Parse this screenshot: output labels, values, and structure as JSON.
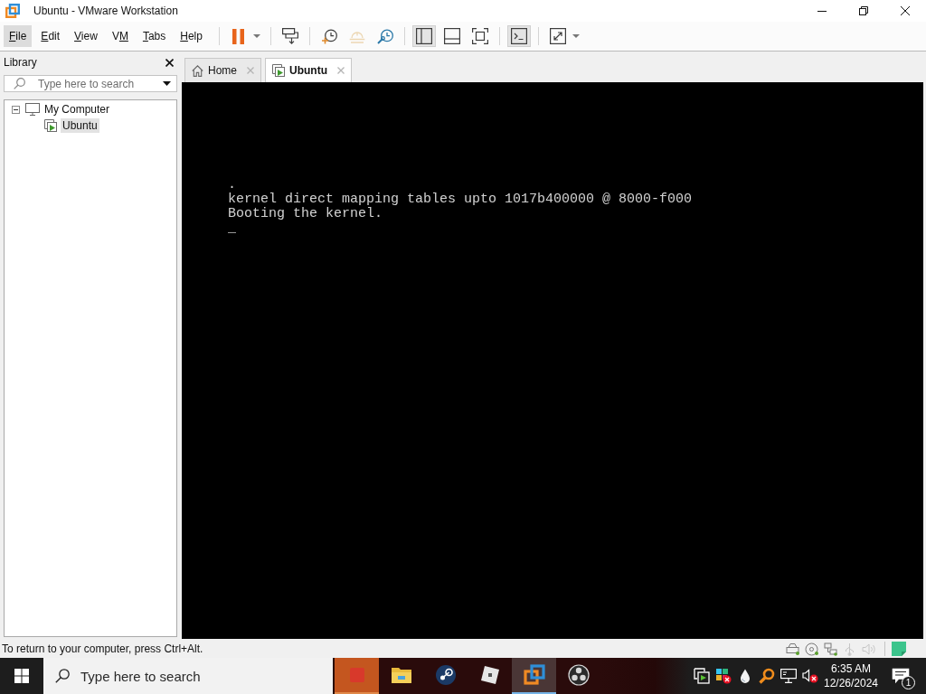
{
  "window": {
    "title": "Ubuntu - VMware Workstation"
  },
  "menu": [
    {
      "mnemonic": "F",
      "after": "ile",
      "selected": true
    },
    {
      "mnemonic": "E",
      "after": "dit",
      "selected": false
    },
    {
      "mnemonic": "V",
      "after": "iew",
      "selected": false
    },
    {
      "before": "V",
      "mnemonic": "M",
      "selected": false
    },
    {
      "mnemonic": "T",
      "after": "abs",
      "selected": false
    },
    {
      "mnemonic": "H",
      "after": "elp",
      "selected": false
    }
  ],
  "toolbar": {
    "groups": [
      {
        "buttons": [
          {
            "pressed": false,
            "disabled": false,
            "dropdown": true
          }
        ]
      },
      {
        "buttons": [
          {
            "pressed": false,
            "disabled": false,
            "dropdown": false
          }
        ]
      },
      {
        "buttons": [
          {
            "pressed": false,
            "disabled": false,
            "dropdown": false
          },
          {
            "pressed": false,
            "disabled": true,
            "dropdown": false
          },
          {
            "pressed": false,
            "disabled": false,
            "dropdown": false
          }
        ]
      },
      {
        "buttons": [
          {
            "pressed": true,
            "disabled": false,
            "dropdown": false
          },
          {
            "pressed": false,
            "disabled": false,
            "dropdown": false
          },
          {
            "pressed": false,
            "disabled": false,
            "dropdown": false
          }
        ]
      },
      {
        "buttons": [
          {
            "pressed": true,
            "disabled": false,
            "dropdown": false
          }
        ]
      },
      {
        "buttons": [
          {
            "pressed": false,
            "disabled": false,
            "dropdown": true
          }
        ]
      }
    ]
  },
  "library": {
    "title": "Library",
    "search": {
      "placeholder": "Type here to search"
    },
    "tree": [
      {
        "label": "My Computer",
        "expanded": true,
        "selected": false,
        "children": [
          {
            "label": "Ubuntu",
            "selected": true
          }
        ]
      }
    ]
  },
  "tabs": [
    {
      "label": "Home",
      "selected": false
    },
    {
      "label": "Ubuntu",
      "selected": true
    }
  ],
  "console": {
    "lines": [
      ".",
      "kernel direct mapping tables upto 1017b400000 @ 8000-f000",
      "Booting the kernel.",
      "_"
    ]
  },
  "status_bar": {
    "message": "To return to your computer, press Ctrl+Alt.",
    "devices": [
      {
        "connected": true
      },
      {
        "connected": true
      },
      {
        "connected": true
      },
      {
        "connected": false
      },
      {
        "connected": false
      }
    ]
  },
  "taskbar": {
    "search": {
      "placeholder": "Type here to search"
    },
    "apps": [
      {
        "flashing": true,
        "selected": false
      },
      {
        "flashing": false,
        "selected": false
      },
      {
        "flashing": false,
        "selected": false
      },
      {
        "flashing": false,
        "selected": false
      },
      {
        "flashing": false,
        "selected": true
      },
      {
        "flashing": false,
        "selected": false
      }
    ],
    "clock": {
      "time": "6:35 AM",
      "date": "12/26/2024"
    },
    "notifications": {
      "badge": "1"
    }
  }
}
